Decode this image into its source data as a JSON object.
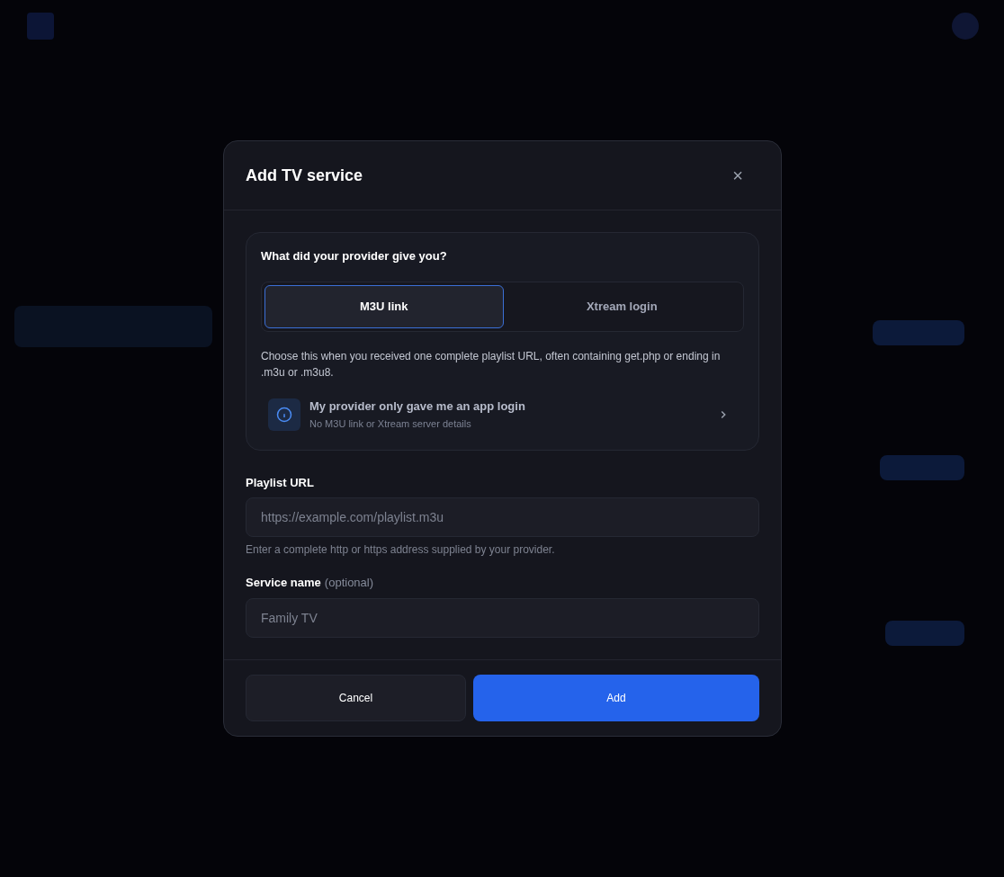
{
  "dialog": {
    "title": "Add TV service",
    "close": "×"
  },
  "source_card": {
    "question": "What did your provider give you?",
    "options": [
      {
        "label": "M3U link",
        "selected": true
      },
      {
        "label": "Xtream login",
        "selected": false
      }
    ],
    "hint": "Choose this when you received one complete playlist URL, often containing get.php or ending in .m3u or .m3u8.",
    "app_login": {
      "title": "My provider only gave me an app login",
      "subtitle": "No M3U link or Xtream server details"
    }
  },
  "fields": [
    {
      "label": "Playlist URL",
      "placeholder": "https://example.com/playlist.m3u",
      "help": "Enter a complete http or https address supplied by your provider."
    },
    {
      "label": "Service name",
      "label_note": "(optional)",
      "placeholder": "Family TV"
    }
  ],
  "buttons": [
    {
      "label": "Cancel",
      "kind": "secondary"
    },
    {
      "label": "Add",
      "kind": "primary"
    }
  ]
}
